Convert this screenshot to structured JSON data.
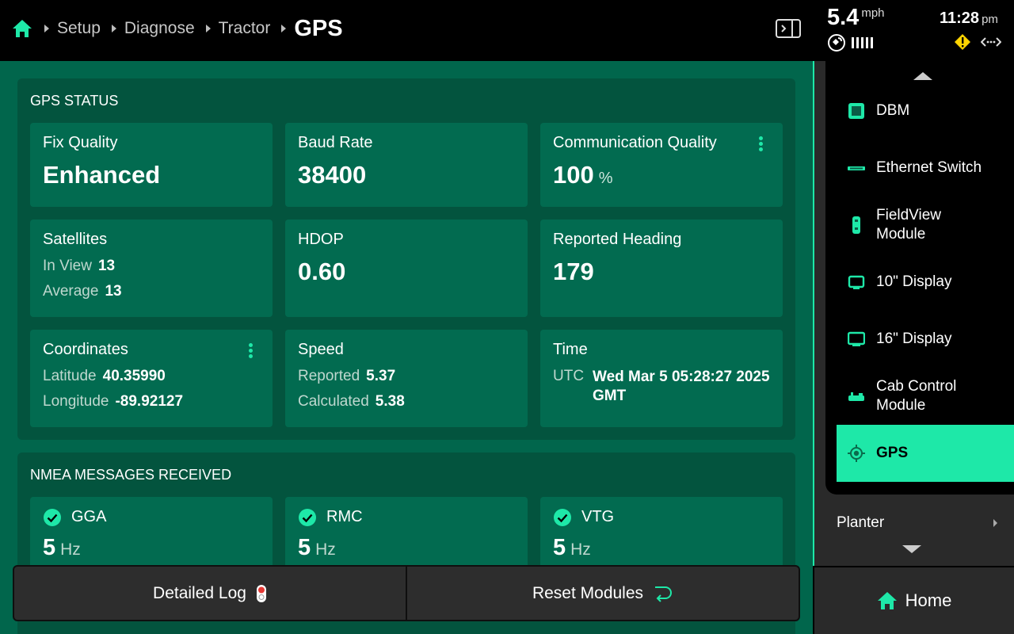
{
  "breadcrumb": {
    "items": [
      "Setup",
      "Diagnose",
      "Tractor"
    ],
    "current": "GPS"
  },
  "status": {
    "speed": "5.4",
    "speed_unit": "mph",
    "time": "11:28",
    "ampm": "pm"
  },
  "gps_status": {
    "title": "GPS STATUS",
    "fix_quality": {
      "label": "Fix Quality",
      "value": "Enhanced"
    },
    "baud_rate": {
      "label": "Baud Rate",
      "value": "38400"
    },
    "comm_quality": {
      "label": "Communication Quality",
      "value": "100",
      "unit": "%"
    },
    "satellites": {
      "label": "Satellites",
      "in_view_label": "In View",
      "in_view": "13",
      "average_label": "Average",
      "average": "13"
    },
    "hdop": {
      "label": "HDOP",
      "value": "0.60"
    },
    "heading": {
      "label": "Reported Heading",
      "value": "179"
    },
    "coordinates": {
      "label": "Coordinates",
      "lat_label": "Latitude",
      "lat": "40.35990",
      "lon_label": "Longitude",
      "lon": "-89.92127"
    },
    "speed": {
      "label": "Speed",
      "reported_label": "Reported",
      "reported": "5.37",
      "calculated_label": "Calculated",
      "calculated": "5.38"
    },
    "time": {
      "label": "Time",
      "utc_label": "UTC",
      "value_line1": "Wed Mar 5 05:28:27 2025",
      "value_line2": "GMT"
    }
  },
  "nmea": {
    "title": "NMEA MESSAGES RECEIVED",
    "messages": [
      {
        "name": "GGA",
        "value": "5",
        "unit": "Hz"
      },
      {
        "name": "RMC",
        "value": "5",
        "unit": "Hz"
      },
      {
        "name": "VTG",
        "value": "5",
        "unit": "Hz"
      }
    ]
  },
  "buttons": {
    "detailed_log": "Detailed Log",
    "reset_modules": "Reset Modules"
  },
  "sidebar": {
    "items": [
      {
        "label": "DBM",
        "icon": "dbm-icon"
      },
      {
        "label": "Ethernet Switch",
        "icon": "ethernet-switch-icon"
      },
      {
        "label": "FieldView Module",
        "icon": "fieldview-module-icon"
      },
      {
        "label": "10\" Display",
        "icon": "display-icon"
      },
      {
        "label": "16\" Display",
        "icon": "display-icon"
      },
      {
        "label": "Cab Control Module",
        "icon": "cab-control-icon"
      },
      {
        "label": "GPS",
        "icon": "gps-icon",
        "active": true
      }
    ],
    "planter": "Planter",
    "home": "Home"
  },
  "colors": {
    "accent": "#1ee8a8",
    "main_bg": "#01664c",
    "section_bg": "#03543e",
    "card_bg": "#026b50",
    "warning": "#ffd400"
  }
}
